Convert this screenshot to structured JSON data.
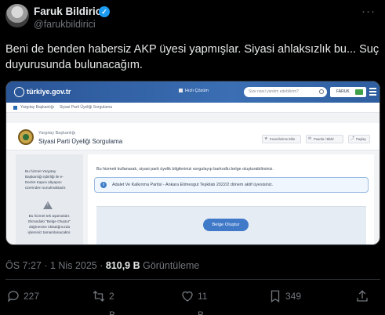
{
  "author": {
    "name": "Faruk Bildirici",
    "handle": "@farukbildirici",
    "verified_icon": "verified-badge-icon"
  },
  "tweet": {
    "text": "Beni de benden habersiz AKP üyesi yapmışlar. Siyasi ahlaksızlık bu...  Suç duyurusunda bulunacağım."
  },
  "embedded_screenshot": {
    "logo": "türkiye.gov.tr",
    "quick_solution": "Hızlı Çözüm",
    "search_placeholder": "Size nasıl yardım edebilirim?",
    "user_label": "FARUK",
    "breadcrumb": [
      "Yargıtay Başkanlığı",
      "Siyasi Parti Üyeliği Sorgulama"
    ],
    "header_small": "Yargıtay Başkanlığı",
    "header_title": "Siyasi Parti Üyeliği Sorgulama",
    "buttons": [
      "Favorilerime Ekle",
      "Puanla / Bildir",
      "Paylaş"
    ],
    "side_text_1": "Bu hizmet Yargıtay Başkanlığı işbirliği ile e-Devlet Kapısı altyapısı üzerinden sunulmaktadır.",
    "side_text_2": "Bu hizmet tek aşamalıdır. Ekrandaki \"Belge Oluştur\" düğmesine tıkladığınızda işleminiz tamamlanacaktır.",
    "intro": "Bu hizmeti kullanarak, siyasi parti üyelik bilgilerinizi sorgulayıp barkodlu belge oluşturabilirsiniz.",
    "info": "Adalet Ve Kalkınma Partisi - Ankara Etimesgut Teşkilatı 2022/2 dönem aktif üyesisiniz.",
    "create_button": "Belge Oluştur"
  },
  "meta": {
    "time": "ÖS 7:27 · 1 Nis 2025 · ",
    "views": "810,9 B",
    "views_label": " Görüntüleme"
  },
  "actions": {
    "replies": "227",
    "reposts": "2 B",
    "likes": "11 B",
    "bookmarks": "349"
  }
}
